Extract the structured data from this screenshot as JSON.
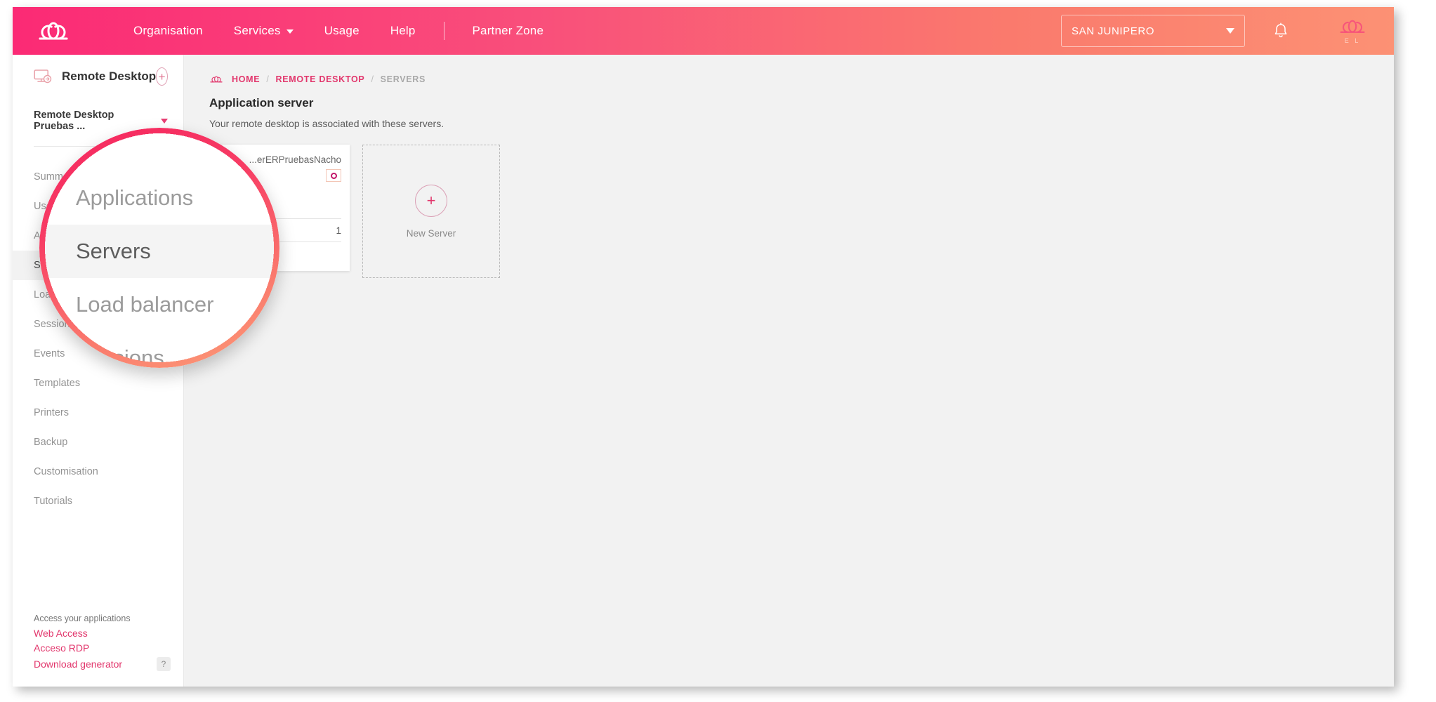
{
  "topbar": {
    "logo_icon": "cloud-logo-icon",
    "nav": [
      {
        "label": "Organisation",
        "caret": false
      },
      {
        "label": "Services",
        "caret": true
      },
      {
        "label": "Usage",
        "caret": false
      },
      {
        "label": "Help",
        "caret": false
      },
      {
        "label": "Partner Zone",
        "caret": false
      }
    ],
    "org_selector": "SAN JUNIPERO",
    "bell_icon": "notification-bell-icon",
    "corner_logo_text": "E L"
  },
  "sidebar": {
    "header": {
      "title": "Remote Desktop",
      "icon": "remote-desktop-icon",
      "add_label": "+"
    },
    "workspace": "Remote Desktop Pruebas ...",
    "items": [
      {
        "label": "Summary",
        "active": false
      },
      {
        "label": "Users",
        "active": false
      },
      {
        "label": "Applications",
        "active": false
      },
      {
        "label": "Servers",
        "active": true
      },
      {
        "label": "Load balancer",
        "active": false
      },
      {
        "label": "Sessions",
        "active": false
      },
      {
        "label": "Events",
        "active": false
      },
      {
        "label": "Templates",
        "active": false
      },
      {
        "label": "Printers",
        "active": false
      },
      {
        "label": "Backup",
        "active": false
      },
      {
        "label": "Customisation",
        "active": false
      },
      {
        "label": "Tutorials",
        "active": false
      }
    ],
    "footer": {
      "label": "Access your applications",
      "links": [
        "Web Access",
        "Acceso RDP",
        "Download generator"
      ],
      "help_badge": "?"
    }
  },
  "main": {
    "breadcrumb": {
      "icon": "cloud-icon",
      "home": "HOME",
      "section": "REMOTE DESKTOP",
      "current": "SERVERS",
      "separator": "/"
    },
    "title": "Application server",
    "subtitle": "Your remote desktop is associated with these servers.",
    "server_card": {
      "name": "...erERPruebasNacho",
      "badge_icon": "power-status-icon",
      "row_value": "1"
    },
    "new_server_card": {
      "plus": "+",
      "label": "New Server"
    }
  },
  "magnifier": {
    "items": [
      {
        "label": "Applications",
        "active": false
      },
      {
        "label": "Servers",
        "active": true
      },
      {
        "label": "Load balancer",
        "active": false
      },
      {
        "label": "Sessions",
        "active": false
      }
    ]
  },
  "colors": {
    "brand_pink": "#fb2a75",
    "brand_orange": "#fc9174",
    "link_pink": "#e2366c",
    "page_bg": "#f2f2f2"
  }
}
